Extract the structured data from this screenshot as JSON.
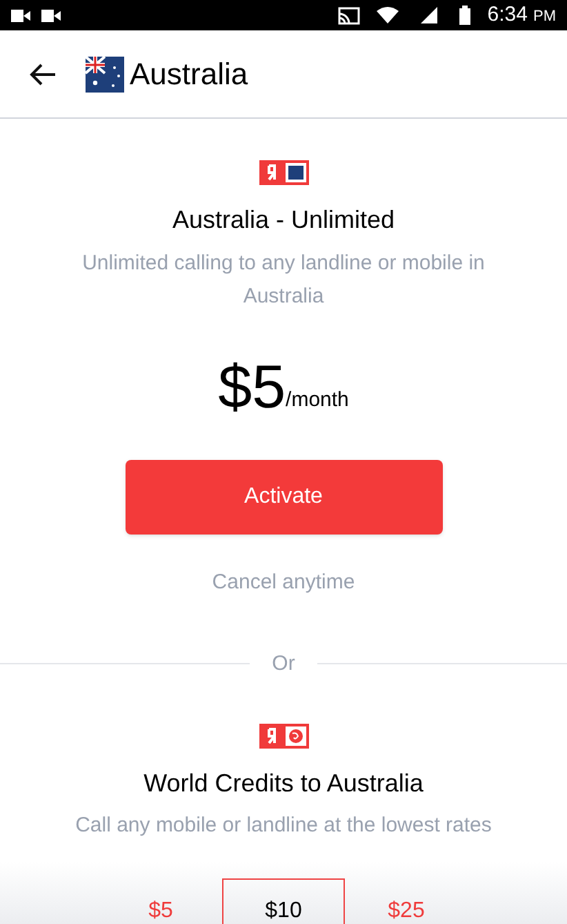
{
  "status_bar": {
    "time": "6:34",
    "ampm": "PM"
  },
  "header": {
    "title": "Australia"
  },
  "plan": {
    "title": "Australia - Unlimited",
    "description": "Unlimited calling to any landline or mobile in Australia",
    "price": "$5",
    "period": "/month",
    "button": "Activate",
    "note": "Cancel anytime"
  },
  "separator": "Or",
  "credits": {
    "title": "World Credits to Australia",
    "description": "Call any mobile or landline at the lowest rates",
    "amounts": [
      {
        "label": "$5",
        "selected": false
      },
      {
        "label": "$10",
        "selected": true
      },
      {
        "label": "$25",
        "selected": false
      }
    ]
  }
}
